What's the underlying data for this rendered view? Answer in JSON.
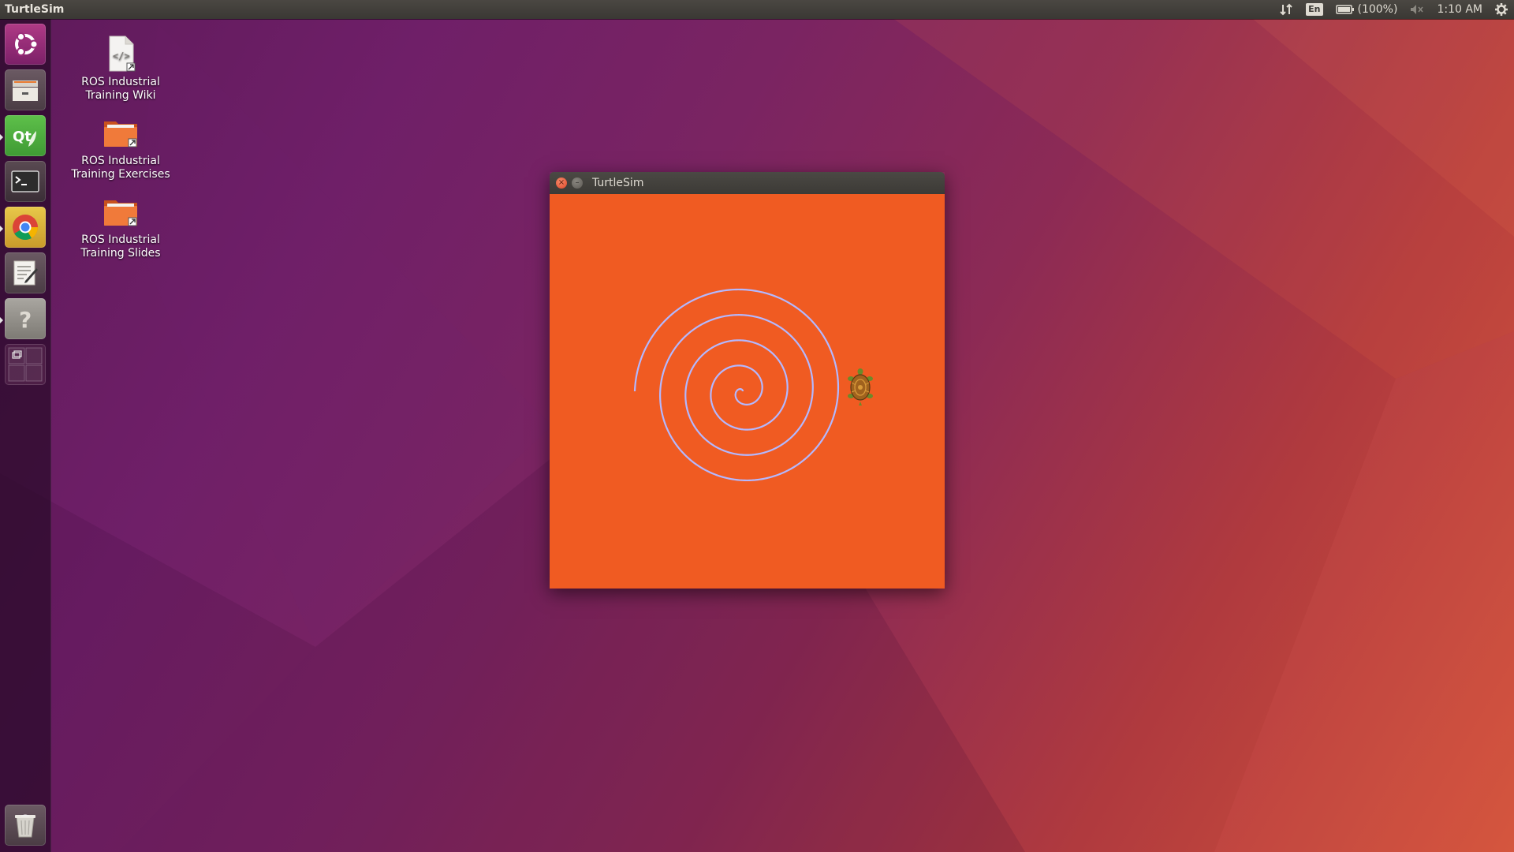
{
  "topbar": {
    "app_title": "TurtleSim",
    "keyboard_layout": "En",
    "battery": "(100%)",
    "time": "1:10 AM"
  },
  "launcher": {
    "items": [
      {
        "name": "ubuntu-dash",
        "icon": "ubuntu-logo-icon"
      },
      {
        "name": "files",
        "icon": "file-cabinet-icon"
      },
      {
        "name": "qt-creator",
        "icon": "qt-logo-icon",
        "label": "Qt"
      },
      {
        "name": "terminal",
        "icon": "terminal-icon"
      },
      {
        "name": "chrome",
        "icon": "chrome-icon"
      },
      {
        "name": "text-editor",
        "icon": "text-editor-icon"
      },
      {
        "name": "help",
        "icon": "help-icon",
        "label": "?"
      },
      {
        "name": "workspace-switcher",
        "icon": "workspace-switcher-icon"
      },
      {
        "name": "trash",
        "icon": "trash-icon"
      }
    ]
  },
  "desktop": {
    "icons": [
      {
        "line1": "ROS Industrial",
        "line2": "Training Wiki",
        "icon": "html-file-icon"
      },
      {
        "line1": "ROS Industrial",
        "line2": "Training Exercises",
        "icon": "folder-icon"
      },
      {
        "line1": "ROS Industrial",
        "line2": "Training Slides",
        "icon": "folder-icon"
      }
    ]
  },
  "window": {
    "title": "TurtleSim",
    "close_glyph": "×",
    "min_glyph": "–",
    "canvas_color": "#f05b22",
    "trail_color": "#b3b8ff"
  }
}
